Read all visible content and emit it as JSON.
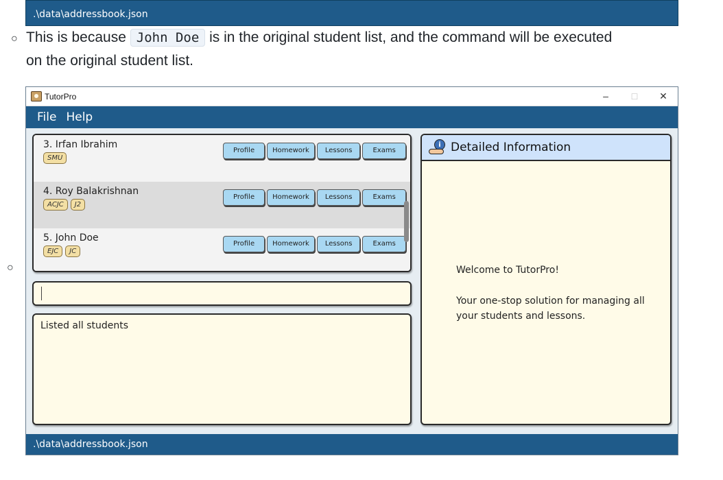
{
  "doc": {
    "top_status_path": ".\\data\\addressbook.json",
    "bullet_line1_prefix": "This is because",
    "bullet_line1_code": "John Doe",
    "bullet_line1_suffix": "is in the original student list, and the command will be executed",
    "bullet_line2": "on the original student list."
  },
  "window": {
    "title": "TutorPro",
    "controls": {
      "minimize": "–",
      "maximize": "□",
      "close": "✕"
    }
  },
  "menu": {
    "file": "File",
    "help": "Help"
  },
  "students": [
    {
      "name": "3.  Irfan Ibrahim",
      "tags": [
        "SMU"
      ]
    },
    {
      "name": "4.  Roy Balakrishnan",
      "tags": [
        "ACJC",
        "J2"
      ]
    },
    {
      "name": "5.  John Doe",
      "tags": [
        "EJC",
        "JC"
      ]
    }
  ],
  "row_buttons": {
    "profile": "Profile",
    "homework": "Homework",
    "lessons": "Lessons",
    "exams": "Exams"
  },
  "command": {
    "value": ""
  },
  "result": {
    "text": "Listed all students"
  },
  "detail": {
    "header": "Detailed Information",
    "welcome": "Welcome to TutorPro!",
    "tagline": "Your one-stop solution for managing all your students and lessons."
  },
  "status_bar": {
    "path": ".\\data\\addressbook.json"
  }
}
